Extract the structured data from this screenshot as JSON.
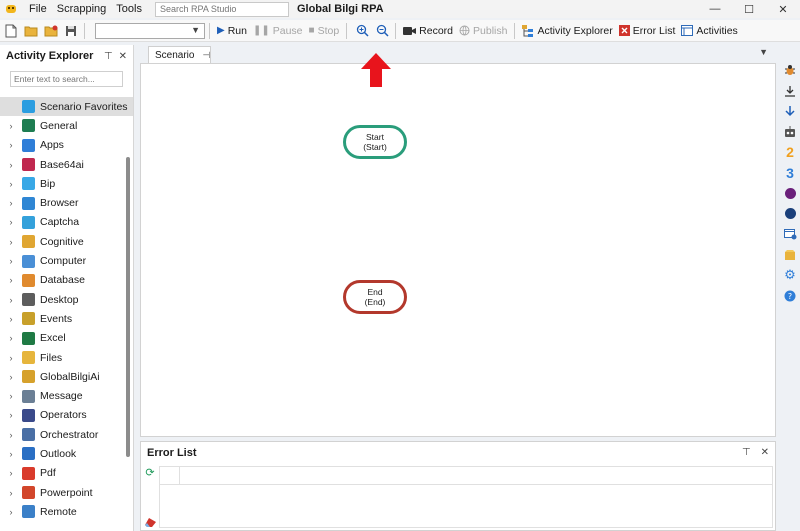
{
  "menu": {
    "items": [
      "File",
      "Scrapping",
      "Tools"
    ]
  },
  "titlebar": {
    "search_placeholder": "Search RPA Studio",
    "app_title": "Global Bilgi RPA"
  },
  "toolbar": {
    "run_label": "Run",
    "pause_label": "Pause",
    "stop_label": "Stop",
    "record_label": "Record",
    "publish_label": "Publish",
    "activity_explorer_label": "Activity Explorer",
    "error_list_label": "Error List",
    "activities_label": "Activities"
  },
  "left_panel": {
    "title": "Activity Explorer",
    "search_placeholder": "Enter text to search...",
    "items": [
      {
        "label": "Scenario Favorites",
        "color": "#2b9de0"
      },
      {
        "label": "General",
        "color": "#1e7d52"
      },
      {
        "label": "Apps",
        "color": "#2f7ed8"
      },
      {
        "label": "Base64ai",
        "color": "#c0284f"
      },
      {
        "label": "Bip",
        "color": "#38a8e6"
      },
      {
        "label": "Browser",
        "color": "#2f86d4"
      },
      {
        "label": "Captcha",
        "color": "#34a1db"
      },
      {
        "label": "Cognitive",
        "color": "#e0a632"
      },
      {
        "label": "Computer",
        "color": "#4a8fd6"
      },
      {
        "label": "Database",
        "color": "#e08a2e"
      },
      {
        "label": "Desktop",
        "color": "#5d5d5d"
      },
      {
        "label": "Events",
        "color": "#c8a02a"
      },
      {
        "label": "Excel",
        "color": "#1f7a44"
      },
      {
        "label": "Files",
        "color": "#e6b53c"
      },
      {
        "label": "GlobalBilgiAi",
        "color": "#d6a12c"
      },
      {
        "label": "Message",
        "color": "#6b7f95"
      },
      {
        "label": "Operators",
        "color": "#3a4a8a"
      },
      {
        "label": "Orchestrator",
        "color": "#4a6fa5"
      },
      {
        "label": "Outlook",
        "color": "#2a6fc4"
      },
      {
        "label": "Pdf",
        "color": "#d93b2c"
      },
      {
        "label": "Powerpoint",
        "color": "#d2462b"
      },
      {
        "label": "Remote",
        "color": "#3b80c8"
      }
    ]
  },
  "scenario": {
    "tab_label": "Scenario",
    "start_node": {
      "line1": "Start",
      "line2": "(Start)"
    },
    "end_node": {
      "line1": "End",
      "line2": "(End)"
    }
  },
  "error_list": {
    "title": "Error List"
  },
  "right_strip": {
    "numbers": [
      "2",
      "3"
    ]
  }
}
